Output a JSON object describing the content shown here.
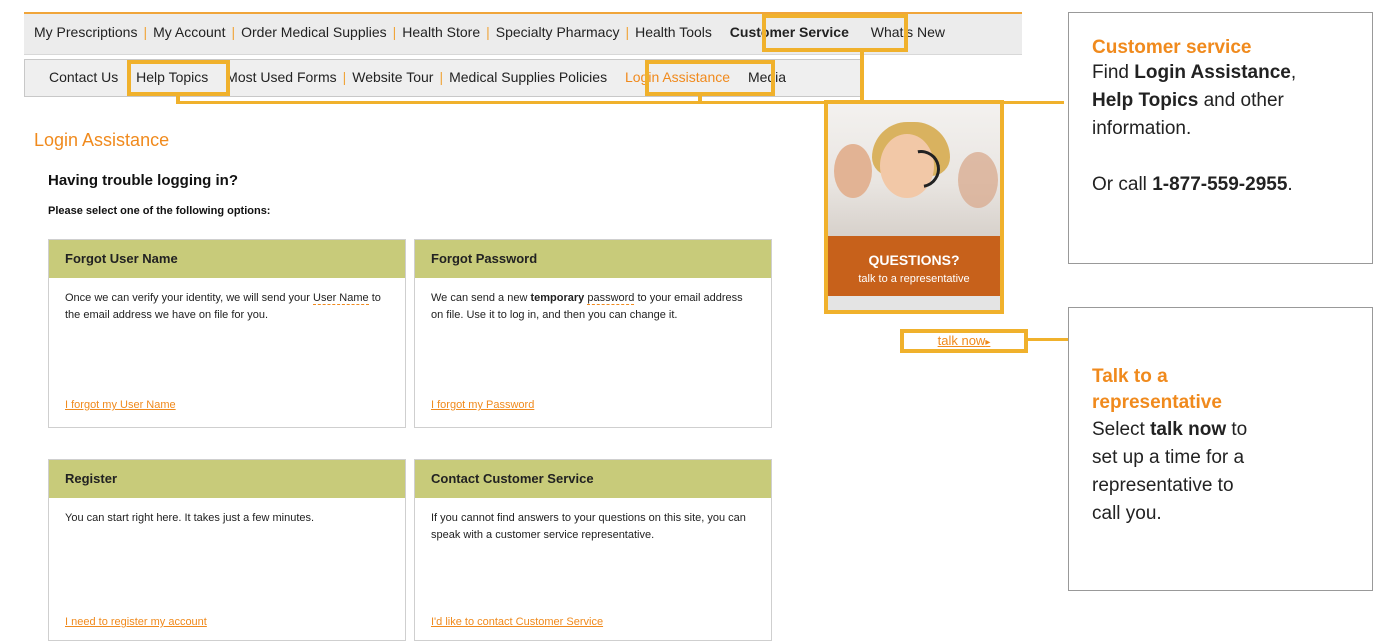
{
  "main_nav": {
    "items": [
      "My Prescriptions",
      "My Account",
      "Order Medical Supplies",
      "Health Store",
      "Specialty Pharmacy",
      "Health Tools",
      "Customer Service",
      "What's New"
    ]
  },
  "sub_nav": {
    "items": [
      "Contact Us",
      "Help Topics",
      "Most Used Forms",
      "Website Tour",
      "Medical Supplies Policies",
      "Login Assistance",
      "Media"
    ]
  },
  "page": {
    "title": "Login Assistance",
    "heading": "Having trouble logging in?",
    "instruction": "Please select one of the following options:"
  },
  "cards": [
    {
      "title": "Forgot User Name",
      "text_pre": "Once we can verify your identity, we will send your ",
      "text_dashed": "User Name",
      "text_post": " to the email address we have on file for you.",
      "link": "I forgot my User Name"
    },
    {
      "title": "Forgot Password",
      "text_pre": "We can send a new ",
      "text_bold": "temporary",
      "text_dashed": "password",
      "text_post": " to your email address on file. Use it to log in, and then you can change it.",
      "link": "I forgot my Password"
    },
    {
      "title": "Register",
      "text": "You can start right here. It takes just a few minutes.",
      "link": "I need to register my account"
    },
    {
      "title": "Contact Customer Service",
      "text": "If you cannot find answers to your questions on this site, you can speak with a customer service representative.",
      "link": "I'd like to contact Customer Service"
    }
  ],
  "promo": {
    "question": "QUESTIONS?",
    "subtext": "talk to a representative",
    "link": "talk now"
  },
  "callouts": {
    "customer_service": {
      "title": "Customer service",
      "find": "Find",
      "login_assistance": "Login Assistance",
      "help_topics": "Help Topics",
      "and_other": "and other",
      "information": "information.",
      "or_call": "Or call",
      "phone": "1-877-559-2955"
    },
    "talk_rep": {
      "title": "Talk to a representative",
      "select": "Select",
      "talk_now": "talk now",
      "to": "to",
      "set_up": "set up a time for a",
      "representative_to": "representative to",
      "call_you": "call you."
    }
  },
  "colors": {
    "accent": "#f08a1d",
    "frame": "#f0b12c",
    "card_head": "#c8cb7a",
    "promo_orange": "#c7611b"
  }
}
